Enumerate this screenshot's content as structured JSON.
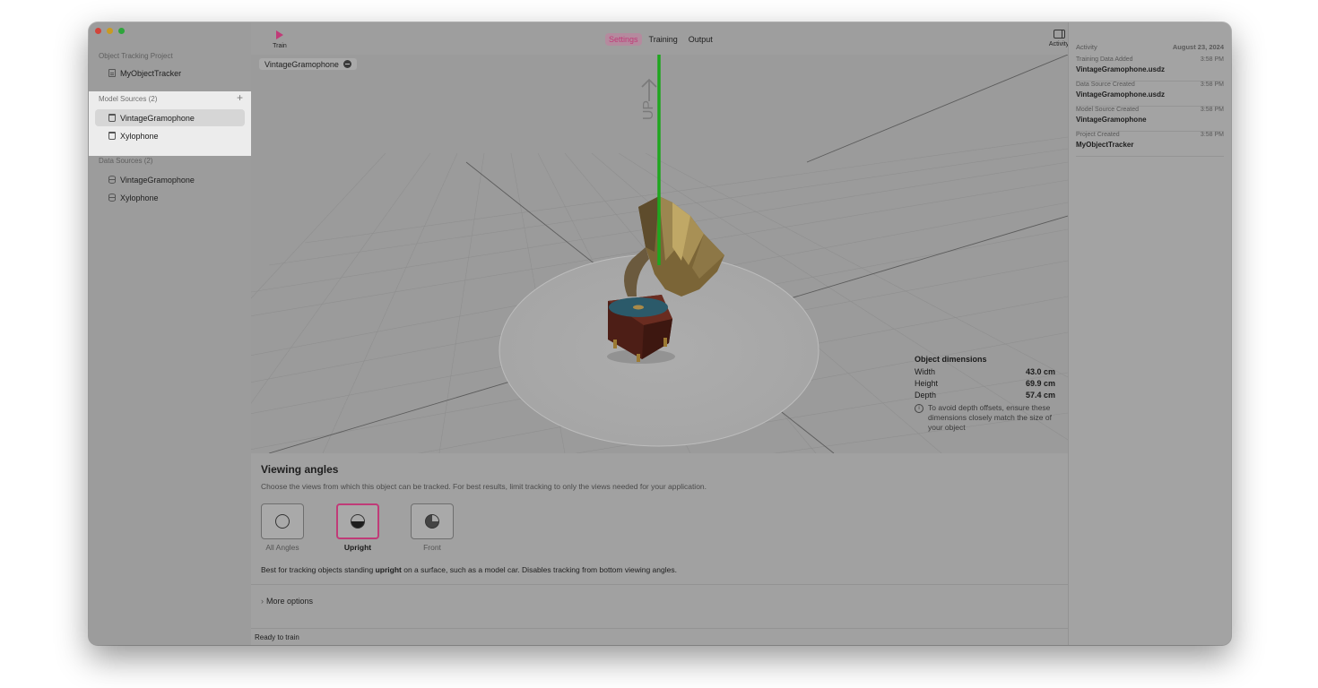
{
  "sidebar": {
    "project_label": "Object Tracking Project",
    "project_item": {
      "label": "MyObjectTracker",
      "icon": "document-icon"
    },
    "model_sources": {
      "header": "Model Sources (2)",
      "items": [
        {
          "label": "VintageGramophone",
          "icon": "model-icon"
        },
        {
          "label": "Xylophone",
          "icon": "model-icon"
        }
      ]
    },
    "data_sources": {
      "header": "Data Sources (2)",
      "items": [
        {
          "label": "VintageGramophone",
          "icon": "database-icon"
        },
        {
          "label": "Xylophone",
          "icon": "database-icon"
        }
      ]
    }
  },
  "toolbar": {
    "train_label": "Train",
    "tabs": [
      {
        "label": "Settings"
      },
      {
        "label": "Training"
      },
      {
        "label": "Output"
      }
    ],
    "activity_label": "Activity"
  },
  "viewport": {
    "object_name": "VintageGramophone",
    "up_label": "UP",
    "dimensions": {
      "title": "Object dimensions",
      "rows": [
        {
          "label": "Width",
          "value": "43.0 cm"
        },
        {
          "label": "Height",
          "value": "69.9 cm"
        },
        {
          "label": "Depth",
          "value": "57.4 cm"
        }
      ],
      "note": "To avoid depth offsets, ensure these dimensions closely match the size of your object"
    }
  },
  "settings": {
    "title": "Viewing angles",
    "description": "Choose the views from which this object can be tracked. For best results, limit tracking to only the views needed for your application.",
    "angles": [
      {
        "label": "All Angles"
      },
      {
        "label": "Upright"
      },
      {
        "label": "Front"
      }
    ],
    "best_prefix": "Best for tracking objects standing ",
    "best_bold": "upright",
    "best_suffix": " on a surface, such as a model car. Disables tracking from bottom viewing angles.",
    "more_options": "More options",
    "status": "Ready to train"
  },
  "inspector": {
    "header": "Activity",
    "date": "August 23, 2024",
    "entries": [
      {
        "event": "Training Data Added",
        "time": "3:58 PM",
        "name": "VintageGramophone.usdz"
      },
      {
        "event": "Data Source Created",
        "time": "3:58 PM",
        "name": "VintageGramophone.usdz"
      },
      {
        "event": "Model Source Created",
        "time": "3:58 PM",
        "name": "VintageGramophone"
      },
      {
        "event": "Project Created",
        "time": "3:58 PM",
        "name": "MyObjectTracker"
      }
    ]
  },
  "colors": {
    "accent": "#c03b78",
    "up_axis": "#1fa61f"
  }
}
